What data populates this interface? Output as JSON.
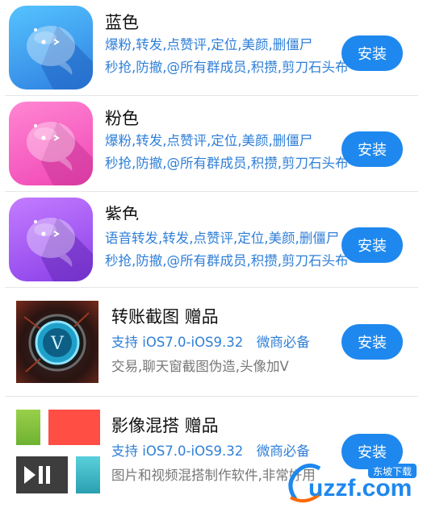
{
  "apps": [
    {
      "name": "蓝色",
      "line1": "爆粉,转发,点赞评,定位,美颜,删僵尸",
      "line2": "秒抢,防撤,@所有群成员,积攒,剪刀石头布",
      "button": "安装",
      "colors": {
        "top": "#55c3ff",
        "bottom": "#2f7fe0"
      }
    },
    {
      "name": "粉色",
      "line1": "爆粉,转发,点赞评,定位,美颜,删僵尸",
      "line2": "秒抢,防撤,@所有群成员,积攒,剪刀石头布",
      "button": "安装",
      "colors": {
        "top": "#ff86d3",
        "bottom": "#f046b5"
      }
    },
    {
      "name": "紫色",
      "line1": "语音转发,转发,点赞评,定位,美颜,删僵尸",
      "line2": "秒抢,防撤,@所有群成员,积攒,剪刀石头布",
      "button": "安装",
      "colors": {
        "top": "#c37cff",
        "bottom": "#8a3fe8"
      }
    },
    {
      "name": "转账截图 赠品",
      "line1": "支持 iOS7.0-iOS9.32　微商必备",
      "line2": "交易,聊天窗截图伪造,头像加V",
      "button": "安装"
    },
    {
      "name": "影像混搭 赠品",
      "line1": "支持 iOS7.0-iOS9.32　微商必备",
      "line2": "图片和视频混搭制作软件,非常好用",
      "button": "安装"
    }
  ],
  "watermark": {
    "text": "uzzf.com",
    "badge": "东坡下载",
    "brand_color": "#1e88ee",
    "accent_color": "#ff6a00"
  }
}
